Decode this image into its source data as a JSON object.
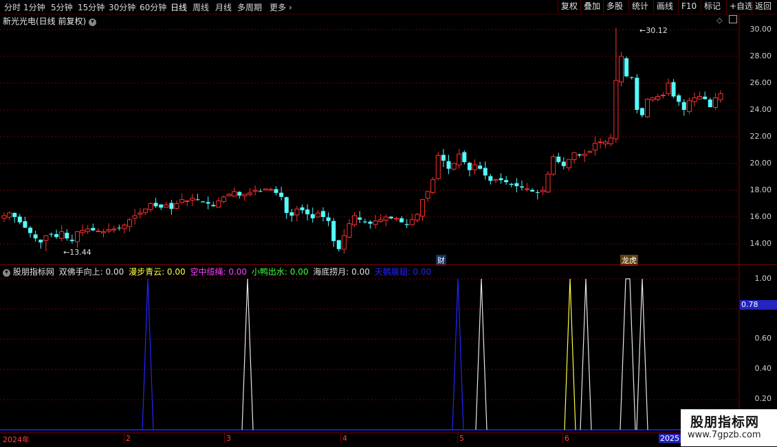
{
  "toolbar": {
    "periods": [
      "分时",
      "1分钟",
      "5分钟",
      "15分钟",
      "30分钟",
      "60分钟",
      "日线",
      "周线",
      "月线",
      "多周期",
      "更多"
    ],
    "active_period": "日线",
    "buttons": [
      "复权",
      "叠加",
      "多股",
      "统计",
      "画线",
      "F10",
      "标记",
      "+自选",
      "返回"
    ]
  },
  "stock": {
    "title": "新光光电(日线 前复权)"
  },
  "price_axis": [
    "30.00",
    "28.00",
    "26.00",
    "24.00",
    "22.00",
    "20.00",
    "18.00",
    "16.00",
    "14.00"
  ],
  "high_label": "30.12",
  "low_label": "13.44",
  "events": [
    "财",
    "龙虎"
  ],
  "indicator": {
    "name": "股朋指标网",
    "items": [
      {
        "label": "双佛手向上: 0.00",
        "color": "#e0e0e0"
      },
      {
        "label": "漫步青云: 0.00",
        "color": "#ffff40"
      },
      {
        "label": "空中缆绳: 0.00",
        "color": "#ff40ff"
      },
      {
        "label": "小鸭出水: 0.00",
        "color": "#40ff40"
      },
      {
        "label": "海底捞月: 0.00",
        "color": "#e0e0e0"
      },
      {
        "label": "天鹅展翅: 0.00",
        "color": "#2424ff"
      }
    ],
    "axis": [
      "1.00",
      "0.80",
      "0.60",
      "0.40",
      "0.20"
    ],
    "current": "0.78"
  },
  "date_axis": [
    "2024年",
    "2",
    "3",
    "4",
    "5",
    "6",
    "2025"
  ],
  "watermark": {
    "name": "股朋指标网",
    "url": "www.7gpzb.com"
  },
  "colors": {
    "up": "#ff3030",
    "down": "#54fcfc",
    "grid": "#7a0000",
    "blue": "#2424ff"
  },
  "chart_data": {
    "type": "candlestick",
    "title": "新光光电(日线 前复权)",
    "ylim": [
      13,
      31
    ],
    "high": 30.12,
    "low": 13.44,
    "closes": [
      16.1,
      16.3,
      16.0,
      15.6,
      15.2,
      14.8,
      14.4,
      14.1,
      14.6,
      14.7,
      14.5,
      14.9,
      14.4,
      14.2,
      14.9,
      15.0,
      15.1,
      15.0,
      14.95,
      14.9,
      15.05,
      15.1,
      15.2,
      15.4,
      15.8,
      16.1,
      16.3,
      16.6,
      17.0,
      16.8,
      16.7,
      16.9,
      16.6,
      17.0,
      17.3,
      17.2,
      17.4,
      17.3,
      17.1,
      17.0,
      16.8,
      17.2,
      17.5,
      17.7,
      17.9,
      17.6,
      17.7,
      17.8,
      18.0,
      17.9,
      18.1,
      18.05,
      17.8,
      17.5,
      16.3,
      16.1,
      16.6,
      16.5,
      16.2,
      15.9,
      16.3,
      16.0,
      15.7,
      14.2,
      13.6,
      14.6,
      15.5,
      16.1,
      15.8,
      15.6,
      15.5,
      15.7,
      15.8,
      16.0,
      15.9,
      15.9,
      15.6,
      15.4,
      15.8,
      16.2,
      17.3,
      17.9,
      18.8,
      20.6,
      20.2,
      19.6,
      20.0,
      20.7,
      20.1,
      19.5,
      19.9,
      19.6,
      19.1,
      18.7,
      18.8,
      18.75,
      18.6,
      18.4,
      18.3,
      18.2,
      18.1,
      17.9,
      17.8,
      18.0,
      19.2,
      20.5,
      20.1,
      19.8,
      20.3,
      20.8,
      20.6,
      20.7,
      20.9,
      21.5,
      21.6,
      21.6,
      21.9,
      26.2,
      28.0,
      26.5,
      26.4,
      24.0,
      23.6,
      24.8,
      24.9,
      25.0,
      25.1,
      26.0,
      25.0,
      24.6,
      24.0,
      24.7,
      24.9,
      25.0,
      24.8,
      24.2,
      24.9,
      25.2
    ]
  }
}
